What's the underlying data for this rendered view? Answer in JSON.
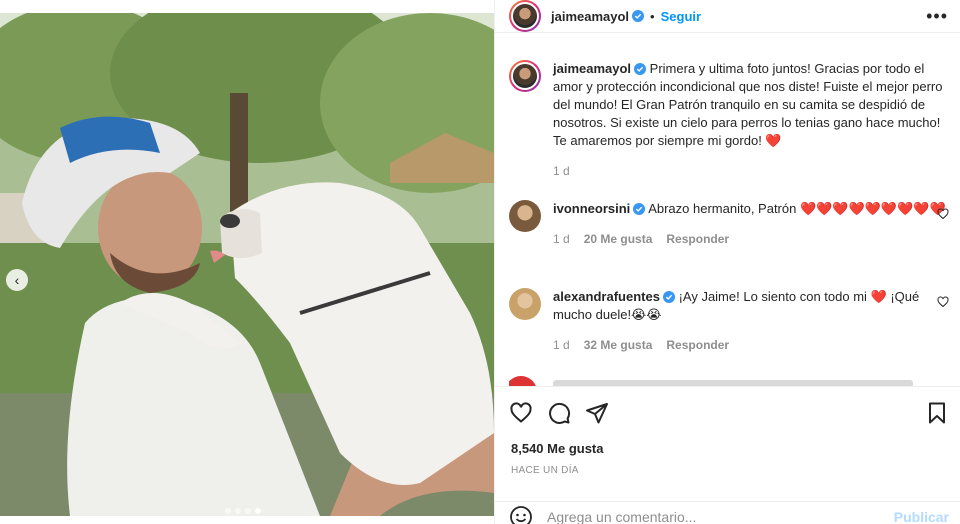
{
  "post": {
    "author": "jaimeamayol",
    "follow_label": "Seguir",
    "follow_separator": "•",
    "more_label": "•••",
    "caption": "Primera y ultima foto juntos! Gracias por todo el amor y protección incondicional que nos diste! Fuiste el mejor perro del mundo! El Gran Patrón tranquilo en su camita se despidió de nosotros. Si existe un cielo para perros lo tenias gano hace mucho! Te amaremos por siempre mi gordo! ❤️",
    "caption_time": "1 d"
  },
  "comments": [
    {
      "username": "ivonneorsini",
      "text": "Abrazo hermanito, Patrón ❤️❤️❤️❤️❤️❤️❤️❤️❤️",
      "time": "1 d",
      "likes": "20 Me gusta",
      "reply": "Responder"
    },
    {
      "username": "alexandrafuentes",
      "text": "¡Ay Jaime! Lo siento con todo mi ❤️ ¡Qué mucho duele!😭😭",
      "time": "1 d",
      "likes": "32 Me gusta",
      "reply": "Responder"
    }
  ],
  "footer": {
    "likes": "8,540 Me gusta",
    "time_ago": "HACE UN DÍA",
    "comment_placeholder": "Agrega un comentario...",
    "publish_label": "Publicar"
  },
  "carousel": {
    "total": 4,
    "active_index": 3
  },
  "colors": {
    "accent": "#0095f6",
    "verified": "#3897f0",
    "heart": "#ed4956",
    "muted": "#8e8e8e"
  }
}
